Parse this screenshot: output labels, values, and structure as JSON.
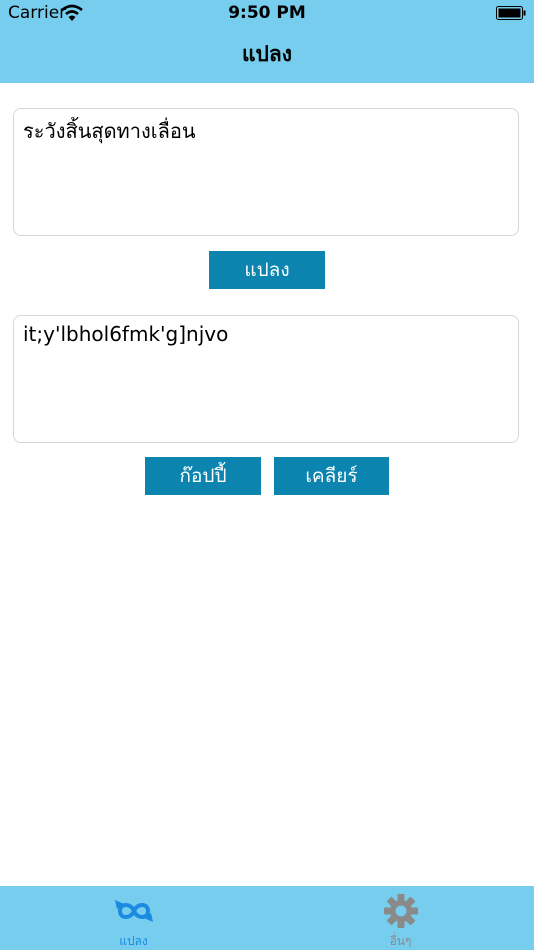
{
  "status_bar": {
    "carrier": "Carrier",
    "time": "9:50 PM"
  },
  "nav": {
    "title": "แปลง"
  },
  "input_text": "ระวังสิ้นสุดทางเลื่อน",
  "convert_button": "แปลง",
  "output_text": "it;y'lbhol6fmk'g]njvo",
  "copy_button": "ก๊อปปี้",
  "clear_button": "เคลียร์",
  "tabs": [
    {
      "label": "แปลง",
      "icon": "convert-arrows-icon",
      "active": true,
      "color": "#1a8be0"
    },
    {
      "label": "อื่นๆ",
      "icon": "gear-icon",
      "active": false,
      "color": "#8a8a8a"
    }
  ],
  "colors": {
    "header": "#76cdee",
    "button": "#0b84b0"
  }
}
